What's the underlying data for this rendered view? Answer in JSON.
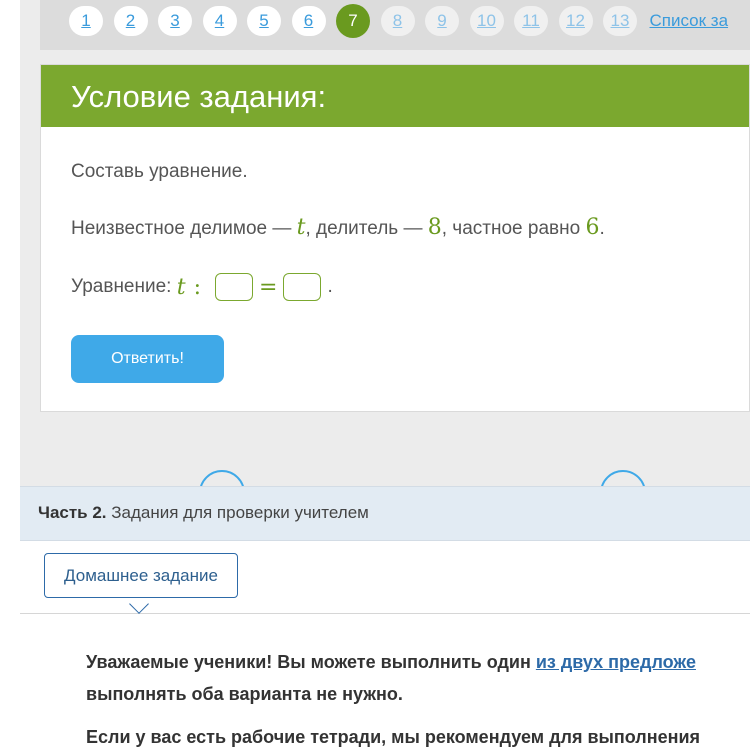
{
  "pager": {
    "pages": [
      "1",
      "2",
      "3",
      "4",
      "5",
      "6",
      "7",
      "8",
      "9",
      "10",
      "11",
      "12",
      "13"
    ],
    "current_index": 6,
    "task_list_link": "Список за"
  },
  "task": {
    "title": "Условие задания:",
    "instruction": "Составь уравнение.",
    "condition": {
      "prefix": "Неизвестное делимое — ",
      "variable": "t",
      "divisor_text": ", делитель — ",
      "divisor": "8",
      "quotient_text": ", частное равно ",
      "quotient": "6",
      "end": "."
    },
    "equation": {
      "label": "Уравнение: ",
      "variable": "t",
      "div_sign": ":",
      "eq_sign": "=",
      "end": "."
    },
    "submit_label": "Ответить!"
  },
  "part2": {
    "bold": "Часть 2.",
    "text": " Задания для проверки учителем"
  },
  "homework_tab": "Домашнее задание",
  "info": {
    "p1_before": "Уважаемые ученики! Вы можете выполнить один ",
    "p1_link": "из двух предложе",
    "p2": "выполнять оба варианта не нужно.",
    "p3": "Если у вас есть рабочие тетради, мы рекомендуем для выполнения"
  },
  "colors": {
    "header_green": "#7ba82f",
    "accent_green": "#6a9a1f",
    "button_blue": "#3fa9e8",
    "link_blue": "#2d6aa8"
  }
}
